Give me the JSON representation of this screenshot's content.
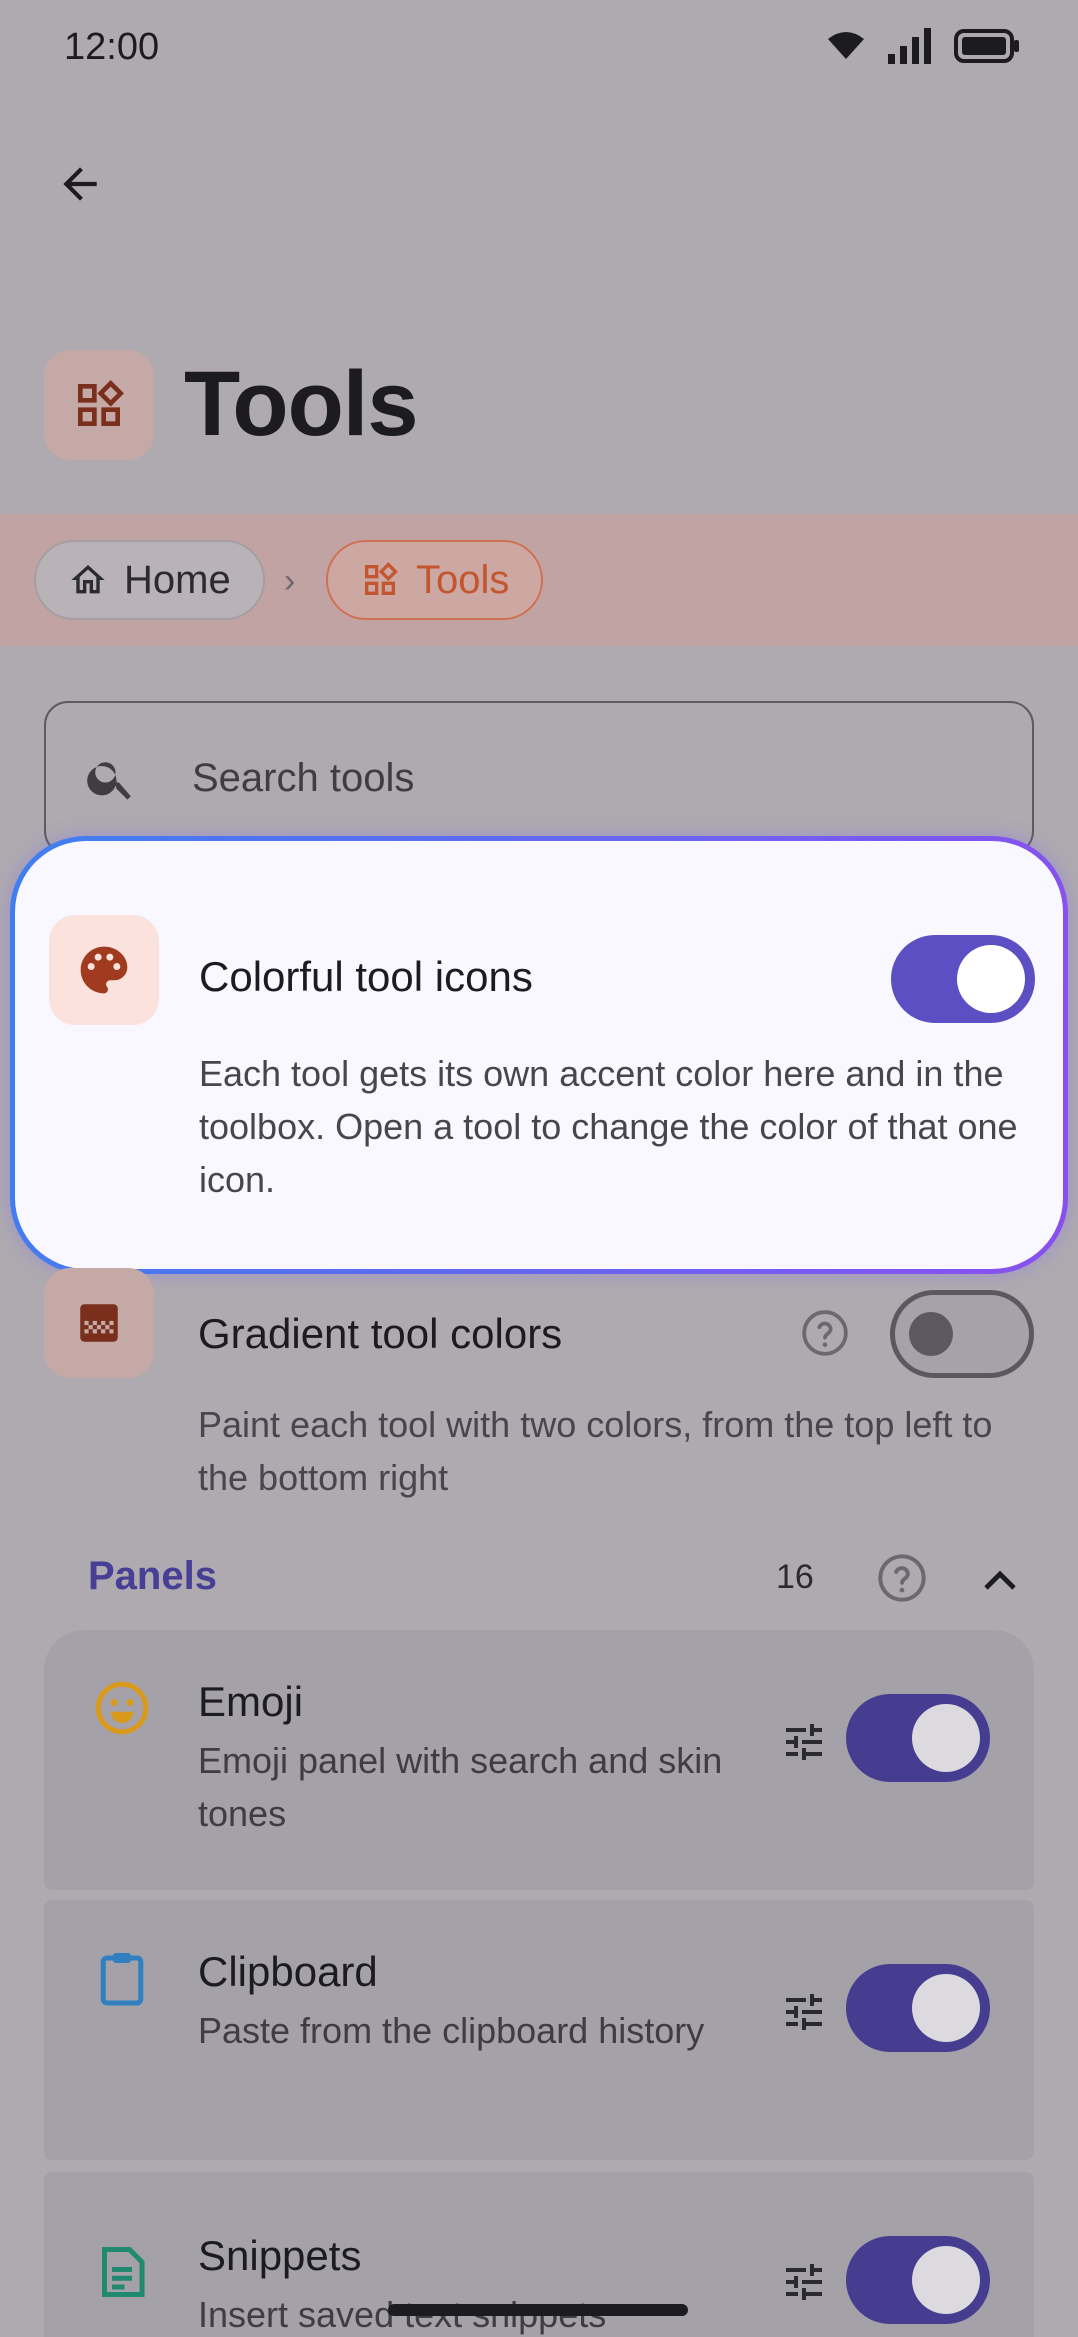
{
  "status_bar": {
    "time": "12:00"
  },
  "header": {
    "title": "Tools"
  },
  "breadcrumb": {
    "home_label": "Home",
    "separator": "›",
    "current_label": "Tools"
  },
  "search": {
    "placeholder": "Search tools"
  },
  "highlight_setting": {
    "title": "Colorful tool icons",
    "description": "Each tool gets its own accent color here and in the toolbox. Open a tool to change the color of that one icon.",
    "enabled": true
  },
  "gradient_setting": {
    "title": "Gradient tool colors",
    "description": "Paint each tool with two colors, from the top left to the bottom right",
    "enabled": false
  },
  "panels_section": {
    "label": "Panels",
    "count": "16",
    "items": [
      {
        "title": "Emoji",
        "description": "Emoji panel with search and skin tones",
        "enabled": true,
        "icon": "emoji-icon",
        "icon_color": "#d99a1c"
      },
      {
        "title": "Clipboard",
        "description": "Paste from the clipboard history",
        "enabled": true,
        "icon": "clipboard-icon",
        "icon_color": "#2f7fc1"
      },
      {
        "title": "Snippets",
        "description": "Insert saved text snippets",
        "enabled": true,
        "icon": "document-icon",
        "icon_color": "#1f8a70"
      }
    ]
  },
  "colors": {
    "accent": "#5b4fc3",
    "brand_orange": "#c3552f",
    "section_label": "#473e95"
  }
}
